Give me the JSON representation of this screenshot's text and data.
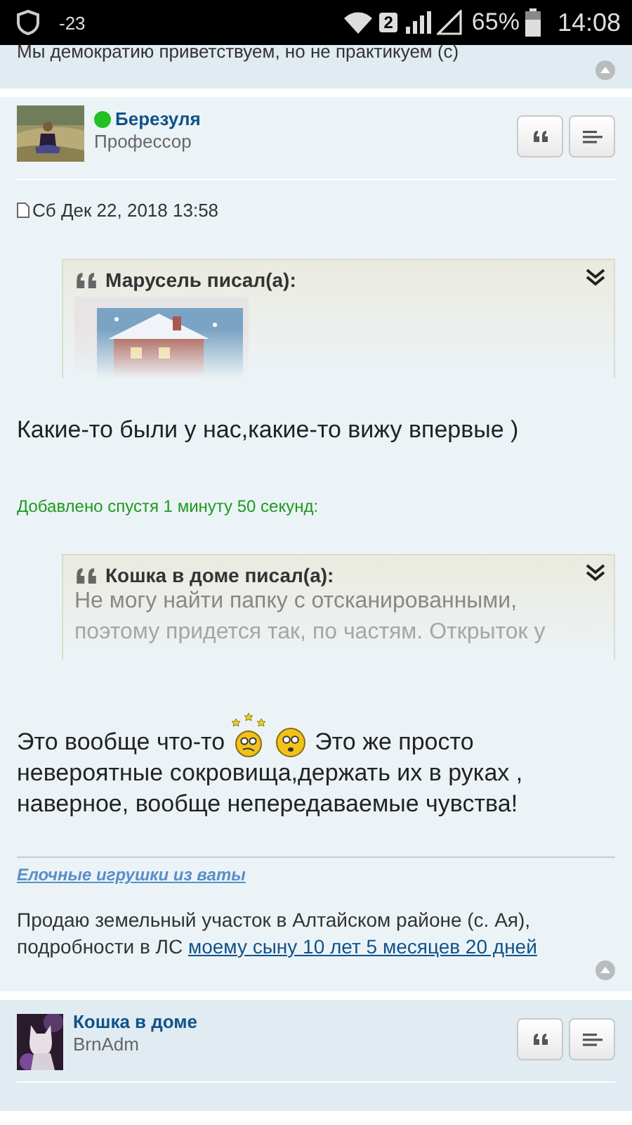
{
  "status_bar": {
    "temperature": "-23",
    "sim_slot": "2",
    "battery": "65%",
    "time": "14:08"
  },
  "previous_post": {
    "signature": "Мы демократию приветствуем, но не практикуем (с)"
  },
  "post": {
    "author": {
      "name": "Березуля",
      "online": true,
      "rank": "Профессор"
    },
    "date": "Сб Дек 22, 2018 13:58",
    "quotes": [
      {
        "author": "Марусель писал(а):"
      },
      {
        "author": "Кошка в доме писал(а):",
        "lines": [
          "Не могу найти папку с отсканированными,",
          "поэтому придется так, по частям. Открыток у"
        ]
      }
    ],
    "text_1": "Какие-то были у нас,какие-то вижу впервые )",
    "added_note": "Добавлено спустя 1 минуту 50 секунд:",
    "text_2_start": "Это вообще что-то",
    "text_2_after_smileys": "Это же просто",
    "text_2_rest": "невероятные сокровища,держать их в руках , наверное, вообще непередаваемые чувства!",
    "signature_link": "Елочные игрушки из ваты",
    "signature_text": "Продаю земельный участок в Алтайском районе (с. Ая), подробности в ЛС",
    "signature_counter": "моему сыну 10 лет 5 месяцев 20 дней"
  },
  "next_post": {
    "author": {
      "name": "Кошка в доме",
      "rank": "BrnAdm"
    }
  }
}
